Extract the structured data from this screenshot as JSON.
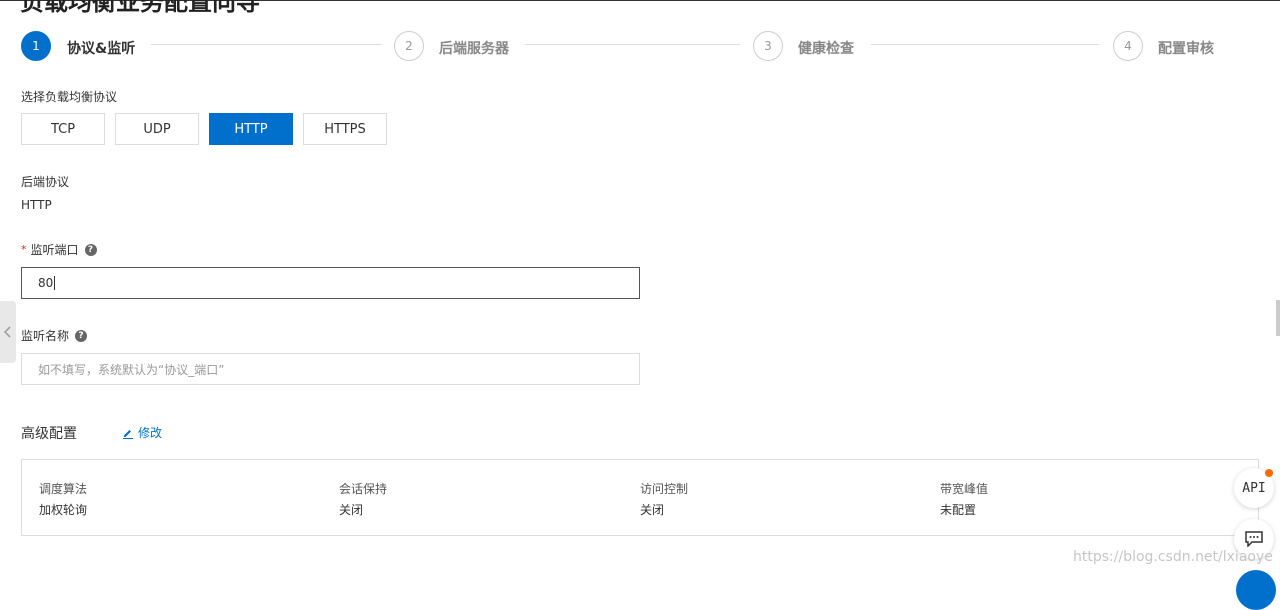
{
  "page": {
    "title": "负载均衡业务配置向导"
  },
  "steps": [
    {
      "number": "1",
      "label": "协议&监听"
    },
    {
      "number": "2",
      "label": "后端服务器"
    },
    {
      "number": "3",
      "label": "健康检查"
    },
    {
      "number": "4",
      "label": "配置审核"
    }
  ],
  "protocol": {
    "label": "选择负载均衡协议",
    "options": [
      "TCP",
      "UDP",
      "HTTP",
      "HTTPS"
    ],
    "selected": "HTTP"
  },
  "backend_protocol": {
    "label": "后端协议",
    "value": "HTTP"
  },
  "listen_port": {
    "required_mark": "*",
    "label": "监听端口",
    "value": "80"
  },
  "listen_name": {
    "label": "监听名称",
    "placeholder": "如不填写，系统默认为“协议_端口”"
  },
  "help_icon": {
    "glyph": "?"
  },
  "advanced": {
    "title": "高级配置",
    "edit_label": "修改",
    "items": [
      {
        "label": "调度算法",
        "value": "加权轮询"
      },
      {
        "label": "会话保持",
        "value": "关闭"
      },
      {
        "label": "访问控制",
        "value": "关闭"
      },
      {
        "label": "带宽峰值",
        "value": "未配置"
      }
    ]
  },
  "floating": {
    "api_label": "API"
  },
  "watermark": "https://blog.csdn.net/lxiaoye",
  "colors": {
    "accent": "#0070cc",
    "notify_dot": "#ff6a00"
  }
}
